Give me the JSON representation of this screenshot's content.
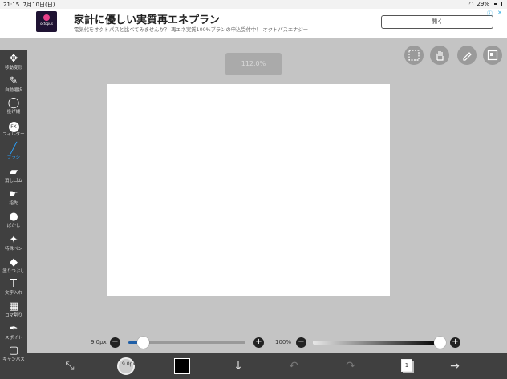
{
  "status_bar": {
    "time": "21:15",
    "date": "7月10日(日)",
    "battery": "29%"
  },
  "ad": {
    "logo_text": "octopus",
    "title": "家計に優しい実質再エネプラン",
    "subtitle": "電気代をオクトパスと比べてみませんか？ 再エネ実質100%プランの申込受付中！ オクトパスエナジー",
    "button": "開く"
  },
  "tools": [
    {
      "name": "move",
      "icon": "move-icon",
      "label": "移動変形",
      "glyph": "✥"
    },
    {
      "name": "magic-wand",
      "icon": "magic-wand-icon",
      "label": "自動選択",
      "glyph": "✎"
    },
    {
      "name": "lasso",
      "icon": "lasso-icon",
      "label": "投げ縄",
      "glyph": "◯"
    },
    {
      "name": "filter",
      "icon": "fx-icon",
      "label": "フィルター",
      "glyph": "FX"
    },
    {
      "name": "brush",
      "icon": "brush-icon",
      "label": "ブラシ",
      "glyph": "╱",
      "active": true
    },
    {
      "name": "eraser",
      "icon": "eraser-icon",
      "label": "消しゴム",
      "glyph": "▰"
    },
    {
      "name": "finger",
      "icon": "finger-icon",
      "label": "指先",
      "glyph": "☛"
    },
    {
      "name": "blur",
      "icon": "blur-drop-icon",
      "label": "ぼかし",
      "glyph": "●"
    },
    {
      "name": "special-pen",
      "icon": "special-pen-icon",
      "label": "特殊ペン",
      "glyph": "✦"
    },
    {
      "name": "fill",
      "icon": "bucket-icon",
      "label": "塗りつぶし",
      "glyph": "◆"
    },
    {
      "name": "text",
      "icon": "text-icon",
      "label": "文字入れ",
      "glyph": "T"
    },
    {
      "name": "frame",
      "icon": "frame-icon",
      "label": "コマ割り",
      "glyph": "▦"
    },
    {
      "name": "eyedropper",
      "icon": "eyedropper-icon",
      "label": "スポイト",
      "glyph": "✒"
    },
    {
      "name": "canvas",
      "icon": "canvas-icon",
      "label": "キャンバス",
      "glyph": "▢"
    }
  ],
  "zoom": "112.0%",
  "brush_size": {
    "label": "9.0px",
    "fraction": 0.12
  },
  "opacity": {
    "label": "100%",
    "fraction": 1.0
  },
  "bottom_buttons": [
    "transform-icon",
    "brush-preview-icon",
    "color-swatch",
    "download-icon",
    "undo-icon",
    "redo-icon",
    "layers-icon",
    "next-icon"
  ],
  "layer_number": "1",
  "colors": {
    "canvas": "#ffffff",
    "toolbar": "#404040",
    "accent": "#2a9df4",
    "current_color": "#000000"
  }
}
